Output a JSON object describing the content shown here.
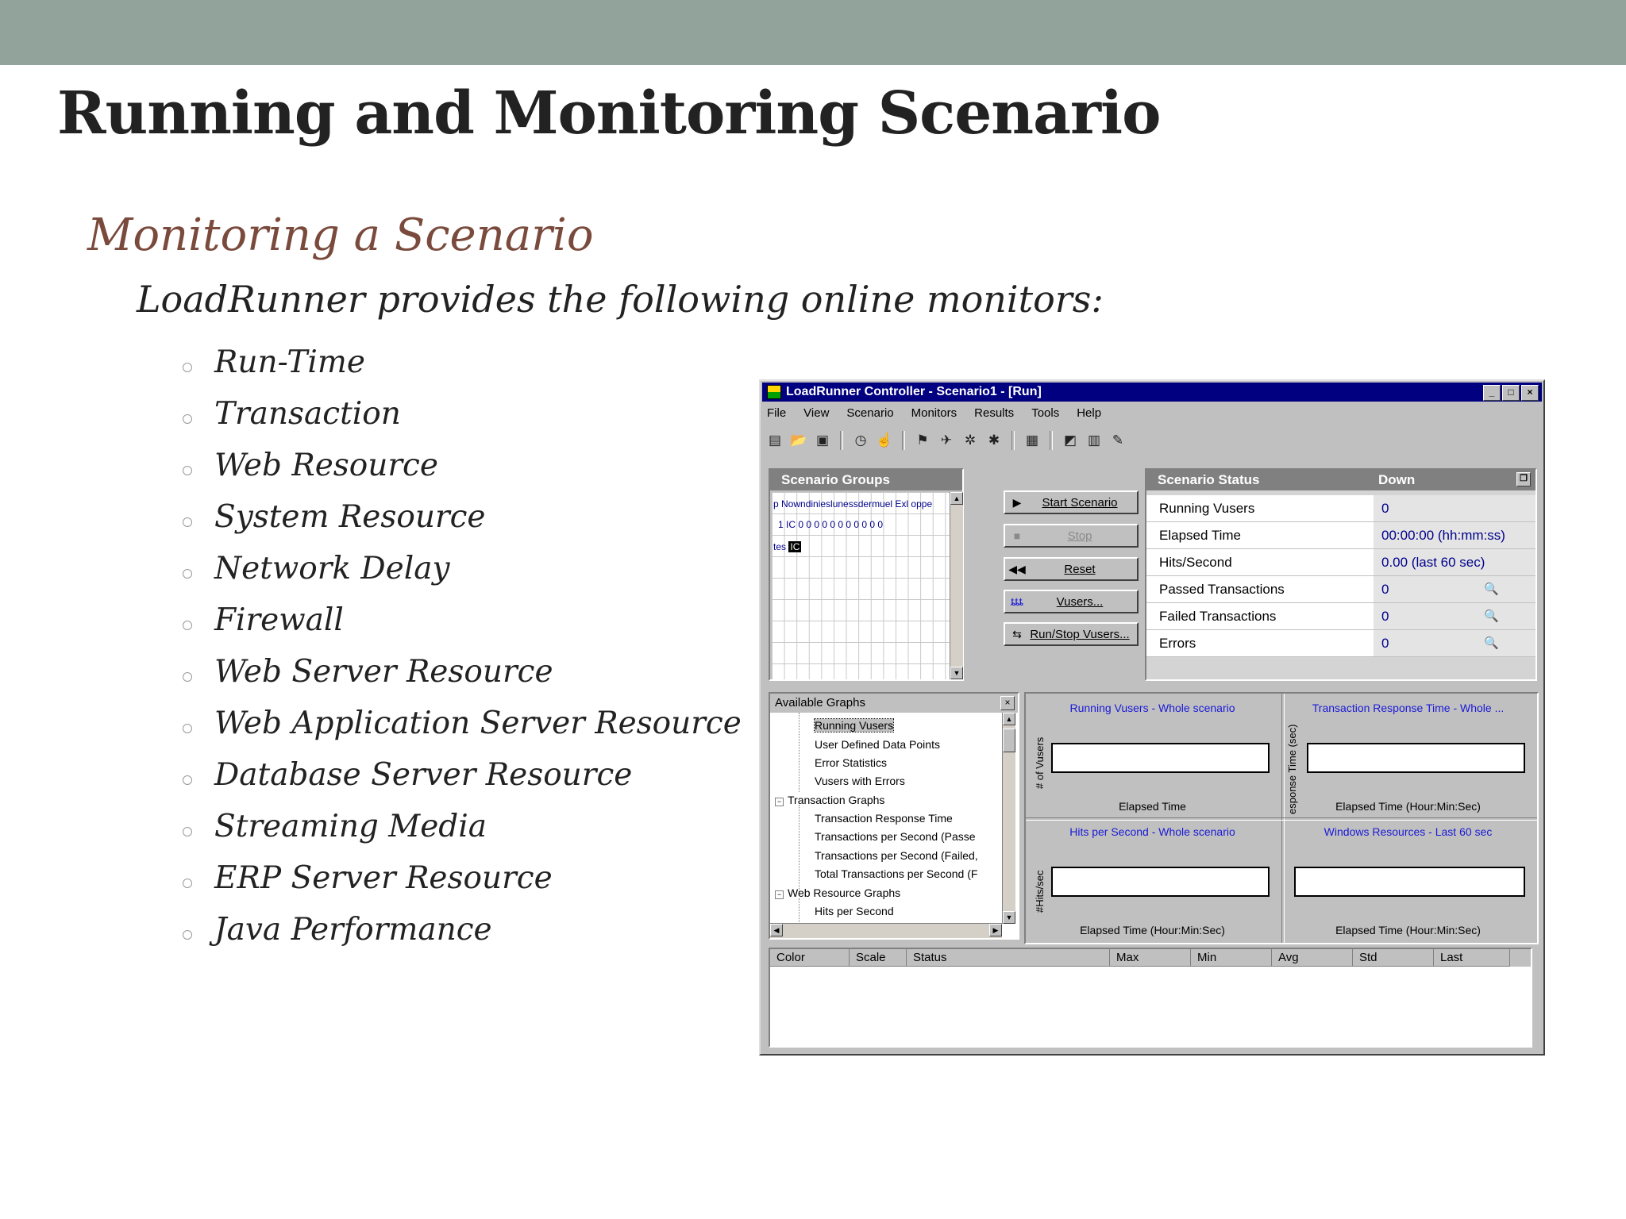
{
  "slide": {
    "title": "Running and Monitoring Scenario",
    "subheading": "Monitoring a Scenario",
    "lead": "LoadRunner provides the following online monitors:",
    "bullets": [
      "Run-Time",
      "Transaction",
      "Web Resource",
      "System Resource",
      "Network Delay",
      "Firewall",
      "Web Server Resource",
      "Web Application Server Resource",
      "Database Server Resource",
      "Streaming Media",
      "ERP Server Resource",
      "Java Performance"
    ],
    "colors": {
      "top_bar": "#91a39a",
      "subheading": "#7a4a3c"
    }
  },
  "window": {
    "title": "LoadRunner Controller - Scenario1 - [Run]",
    "controls": [
      "_",
      "□",
      "×"
    ],
    "menu": [
      "File",
      "View",
      "Scenario",
      "Monitors",
      "Results",
      "Tools",
      "Help"
    ],
    "toolbar_icons": [
      "new-icon",
      "open-icon",
      "save-icon",
      "clock-icon",
      "hand-icon",
      "runner-icon",
      "run-icon",
      "stop-run-icon",
      "gradual-stop-icon",
      "results-icon",
      "analysis-icon",
      "graph-icon",
      "wizard-icon"
    ],
    "scenario_groups": {
      "header": "Scenario Groups",
      "column_row": "p Nowndinieslunessdermuel Exl oppe",
      "data_row": "1  IC 0  0 0 0 0 0 0 0  0  0  0",
      "third_row_prefix": "tes",
      "third_row_cell": "IC"
    },
    "buttons": [
      {
        "label": "Start Scenario",
        "icon": "▶",
        "enabled": true
      },
      {
        "label": "Stop",
        "icon": "■",
        "enabled": false
      },
      {
        "label": "Reset",
        "icon": "◀◀",
        "enabled": true
      },
      {
        "label": "Vusers...",
        "icon": "ȶȶȶ",
        "enabled": true
      },
      {
        "label": "Run/Stop Vusers...",
        "icon": "⇆",
        "enabled": true
      }
    ],
    "scenario_status": {
      "header": "Scenario Status",
      "state": "Down",
      "rows": [
        {
          "name": "Running Vusers",
          "value": "0",
          "magnifier": false
        },
        {
          "name": "Elapsed Time",
          "value": "00:00:00 (hh:mm:ss)",
          "magnifier": false
        },
        {
          "name": "Hits/Second",
          "value": "0.00 (last 60 sec)",
          "magnifier": false
        },
        {
          "name": "Passed Transactions",
          "value": "0",
          "magnifier": true
        },
        {
          "name": "Failed Transactions",
          "value": "0",
          "magnifier": true
        },
        {
          "name": "Errors",
          "value": "0",
          "magnifier": true
        }
      ]
    },
    "available_graphs": {
      "header": "Available Graphs",
      "items": [
        {
          "label": "Running Vusers",
          "selected": true
        },
        {
          "label": "User Defined Data Points"
        },
        {
          "label": "Error Statistics"
        },
        {
          "label": "Vusers with Errors"
        },
        {
          "label": "Transaction Graphs",
          "group": true
        },
        {
          "label": "Transaction Response Time"
        },
        {
          "label": "Transactions per Second (Passe"
        },
        {
          "label": "Transactions per Second (Failed,"
        },
        {
          "label": "Total Transactions per Second (F"
        },
        {
          "label": "Web Resource Graphs",
          "group": true
        },
        {
          "label": "Hits per Second"
        }
      ]
    },
    "graphs": [
      {
        "title": "Running Vusers - Whole scenario",
        "ylabel": "# of Vusers",
        "xlabel": "Elapsed Time"
      },
      {
        "title": "Transaction Response Time - Whole ...",
        "ylabel": "esponse Time (sec)",
        "xlabel": "Elapsed Time (Hour:Min:Sec)"
      },
      {
        "title": "Hits per Second - Whole scenario",
        "ylabel": "#Hits/sec",
        "xlabel": "Elapsed Time (Hour:Min:Sec)"
      },
      {
        "title": "Windows Resources - Last 60 sec",
        "ylabel": "",
        "xlabel": "Elapsed Time (Hour:Min:Sec)"
      }
    ],
    "legend_columns": [
      "Color",
      "Scale",
      "Status",
      "Max",
      "Min",
      "Avg",
      "Std",
      "Last"
    ],
    "colors": {
      "titlebar": "#000080",
      "face": "#c0c0c0",
      "graph_title": "#1a1ad6",
      "value_text": "#00008b"
    }
  }
}
